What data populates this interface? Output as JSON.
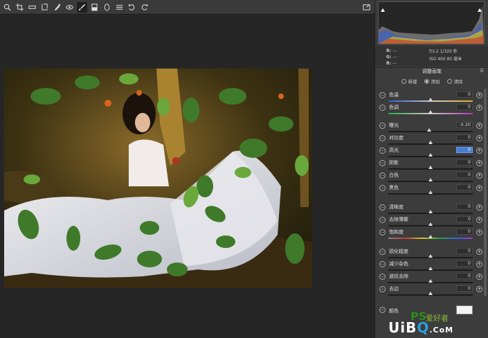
{
  "toolbar": {
    "tools": [
      "zoom-icon",
      "hand-icon",
      "white-balance-icon",
      "crop-icon",
      "straighten-icon",
      "transform-icon",
      "spot-removal-icon",
      "red-eye-icon",
      "adjustment-brush-icon",
      "graduated-filter-icon",
      "radial-filter-icon",
      "list-icon",
      "rotate-left-icon",
      "rotate-right-icon"
    ],
    "active_tool": "adjustment-brush-icon",
    "right_icon": "fullscreen-icon"
  },
  "info": {
    "r_label": "R:",
    "g_label": "G:",
    "b_label": "B:",
    "r_value": "---",
    "g_value": "---",
    "b_value": "---",
    "exif_line1": "f/3.2   1/320 秒",
    "exif_line2": "ISO 400   85 毫米"
  },
  "panel": {
    "title": "调整画笔",
    "modes": [
      {
        "label": "新建",
        "selected": false
      },
      {
        "label": "添加",
        "selected": true
      },
      {
        "label": "清除",
        "selected": false
      }
    ],
    "sliders": [
      {
        "label": "色温",
        "value": "0",
        "pos": 0.5
      },
      {
        "label": "色调",
        "value": "0",
        "pos": 0.5
      },
      {
        "label": "曝光",
        "value": "-0.20",
        "pos": 0.48
      },
      {
        "label": "对比度",
        "value": "0",
        "pos": 0.5
      },
      {
        "label": "高光",
        "value": "0",
        "pos": 0.5,
        "selected": true
      },
      {
        "label": "阴影",
        "value": "0",
        "pos": 0.5
      },
      {
        "label": "白色",
        "value": "0",
        "pos": 0.5
      },
      {
        "label": "黑色",
        "value": "0",
        "pos": 0.5
      },
      {
        "label": "清晰度",
        "value": "0",
        "pos": 0.5
      },
      {
        "label": "去除薄雾",
        "value": "0",
        "pos": 0.5
      },
      {
        "label": "饱和度",
        "value": "0",
        "pos": 0.5
      },
      {
        "label": "锐化程度",
        "value": "0",
        "pos": 0.5
      },
      {
        "label": "减少杂色",
        "value": "0",
        "pos": 0.5
      },
      {
        "label": "波纹去除",
        "value": "0",
        "pos": 0.5
      },
      {
        "label": "去边",
        "value": "0",
        "pos": 0.5
      }
    ],
    "color_label": "颜色"
  },
  "watermark": {
    "ps": "PS",
    "site": "爱好者",
    "brand_u": "U",
    "brand_i": "i",
    "brand_b": "B",
    "brand_o": "Q",
    "brand_tail": ".CoM"
  }
}
